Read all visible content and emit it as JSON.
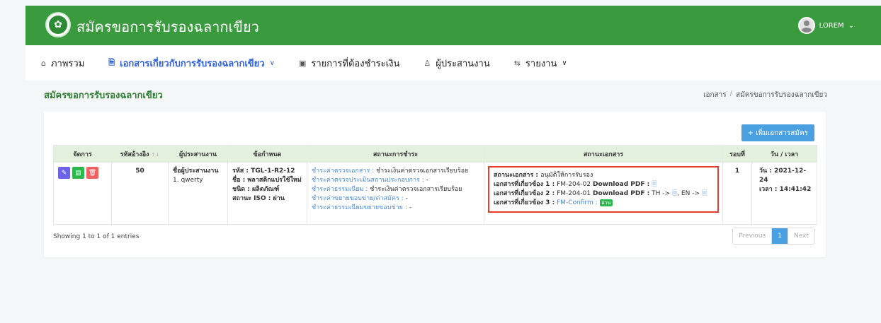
{
  "app": {
    "title": "สมัครขอการรับรองฉลากเขียว",
    "user_name": "LOREM"
  },
  "nav": [
    {
      "label": "ภาพรวม",
      "icon": "home-icon",
      "glyph": "⌂",
      "chevron": "",
      "active": false
    },
    {
      "label": "เอกสารเกี่ยวกับการรับรองฉลากเขียว",
      "icon": "document-icon",
      "glyph": "🗎",
      "chevron": "∨",
      "active": true
    },
    {
      "label": "รายการที่ต้องชำระเงิน",
      "icon": "payment-icon",
      "glyph": "▣",
      "chevron": "",
      "active": false
    },
    {
      "label": "ผู้ประสานงาน",
      "icon": "person-icon",
      "glyph": "♙",
      "chevron": "",
      "active": false
    },
    {
      "label": "รายงาน",
      "icon": "report-icon",
      "glyph": "⇆",
      "chevron": "∨",
      "active": false
    }
  ],
  "page": {
    "title": "สมัครขอการรับรองฉลากเขียว",
    "breadcrumb": [
      "เอกสาร",
      "สมัครขอการรับรองฉลากเขียว"
    ],
    "breadcrumb_sep": "/"
  },
  "add_button": "+ เพิ่มเอกสารสมัคร",
  "columns": [
    "จัดการ",
    "รหัสอ้างอิง",
    "ผู้ประสานงาน",
    "ข้อกำหนด",
    "สถานะการชำระ",
    "สถานะเอกสาร",
    "รอบที่",
    "วัน / เวลา"
  ],
  "sort_indicator": "↑↓",
  "row": {
    "ref": "50",
    "coordinator": {
      "name": "ชื่อผู้ประสานงาน",
      "value": "1. qwerty"
    },
    "requirement": [
      "รหัส : TGL-1-R2-12",
      "ชื่อ : พลาสติกแปรใช้ใหม่",
      "ชนิด : ผลิตภัณฑ์",
      "สถานะ ISO : ผ่าน"
    ],
    "payment": [
      {
        "label": "ชำระค่าตรวจเอกสาร :",
        "value": "ชำระเงินค่าตรวจเอกสารเรียบร้อย"
      },
      {
        "label": "ชำระค่าตรวจประเมินสถานประกอบการ :",
        "value": "-"
      },
      {
        "label": "ชำระค่าธรรมเนียม :",
        "value": "ชำระเงินค่าตรวจเอกสารเรียบร้อย"
      },
      {
        "label": "ชำระค่าขยายขอบข่าย/ค่าสมัคร :",
        "value": "-"
      },
      {
        "label": "ชำระค่าธรรมเนียมขยายขอบข่าย :",
        "value": "-"
      }
    ],
    "doc_status": {
      "status_label": "สถานะเอกสาร :",
      "status_value": "อนุมัติให้การรับรอง",
      "doc1_label": "เอกสารที่เกี่ยวข้อง 1 :",
      "doc1_code": "FM-204-02",
      "download": "Download PDF :",
      "doc2_label": "เอกสารที่เกี่ยวข้อง 2 :",
      "doc2_code": "FM-204-01",
      "th": "TH ->",
      "en": ", EN ->",
      "doc3_label": "เอกสารที่เกี่ยวข้อง 3 :",
      "doc3_link": "FM-Confirm :",
      "doc3_badge": "ผ่าน"
    },
    "round": "1",
    "date": "วัน : 2021-12-24",
    "time": "เวลา : 14:41:42"
  },
  "footer": {
    "showing": "Showing 1 to 1 of 1 entries",
    "prev": "Previous",
    "page": "1",
    "next": "Next"
  }
}
